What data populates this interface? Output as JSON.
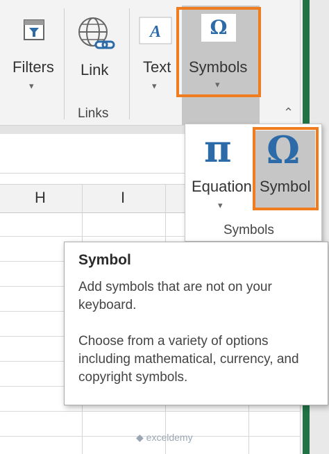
{
  "ribbon": {
    "filters_label": "Filters",
    "link_label": "Link",
    "links_group_label": "Links",
    "text_label": "Text",
    "symbols_label": "Symbols",
    "caret": "▾",
    "collapse_caret": "⌃"
  },
  "grid": {
    "column_headers": [
      "H",
      "I"
    ]
  },
  "symbols_popup": {
    "equation_label": "Equation",
    "equation_glyph": "π",
    "symbol_label": "Symbol",
    "symbol_glyph": "Ω",
    "group_label": "Symbols",
    "caret": "▾"
  },
  "tooltip": {
    "title": "Symbol",
    "paragraph1": "Add symbols that are not on your keyboard.",
    "paragraph2": "Choose from a variety of options including mathematical, currency, and copyright symbols."
  },
  "watermark": {
    "text": "exceldemy"
  },
  "colors": {
    "accent_orange": "#f07c20",
    "excel_green": "#217346",
    "icon_blue": "#2c6aa8"
  }
}
